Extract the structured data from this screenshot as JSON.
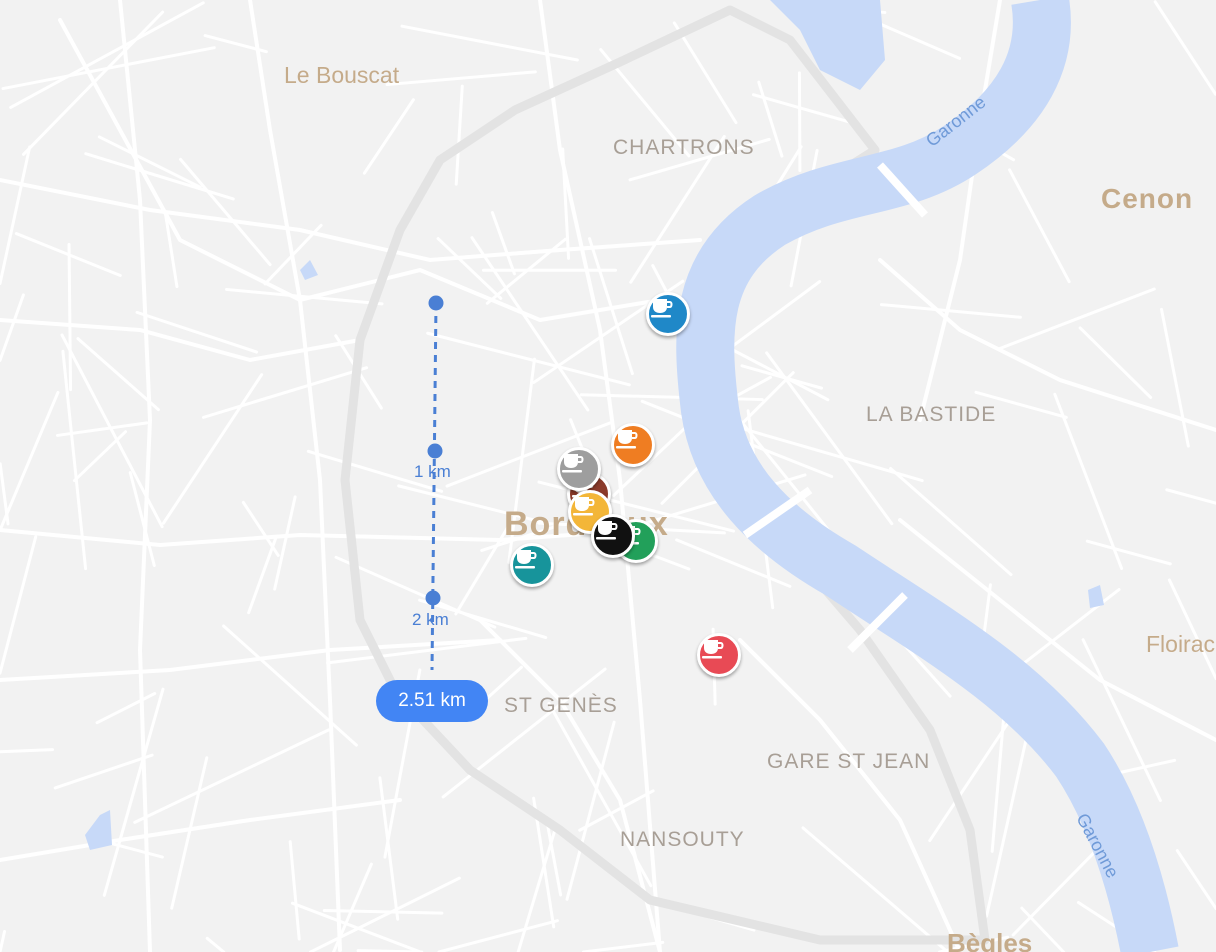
{
  "map": {
    "place_labels": [
      {
        "key": "le_bouscat",
        "text": "Le Bouscat"
      },
      {
        "key": "chartrons",
        "text": "CHARTRONS"
      },
      {
        "key": "cenon",
        "text": "Cenon"
      },
      {
        "key": "la_bastide",
        "text": "LA BASTIDE"
      },
      {
        "key": "bordeaux",
        "text": "Bordeaux"
      },
      {
        "key": "st_genes",
        "text": "ST GENÈS"
      },
      {
        "key": "gare_st_jean",
        "text": "GARE ST JEAN"
      },
      {
        "key": "nansouty",
        "text": "NANSOUTY"
      },
      {
        "key": "floirac",
        "text": "Floirac"
      },
      {
        "key": "begles",
        "text": "Bègles"
      }
    ],
    "river_labels": [
      {
        "key": "garonne_north",
        "text": "Garonne"
      },
      {
        "key": "garonne_south",
        "text": "Garonne"
      }
    ]
  },
  "measurement": {
    "markers": [
      {
        "key": "marker_1",
        "text": "1 km"
      },
      {
        "key": "marker_2",
        "text": "2 km"
      }
    ],
    "total": "2.51 km"
  },
  "cafe_pins": [
    {
      "key": "blue",
      "color": "#1f88c8",
      "icon": "coffee-cup-icon"
    },
    {
      "key": "orange",
      "color": "#ef7d22",
      "icon": "coffee-cup-icon"
    },
    {
      "key": "gray",
      "color": "#9e9e9e",
      "icon": "coffee-cup-icon"
    },
    {
      "key": "brown",
      "color": "#8b3a2a",
      "icon": "coffee-cup-icon"
    },
    {
      "key": "yellow",
      "color": "#f3b638",
      "icon": "coffee-cup-icon"
    },
    {
      "key": "green",
      "color": "#22a05a",
      "icon": "coffee-cup-icon"
    },
    {
      "key": "black",
      "color": "#111111",
      "icon": "coffee-cup-icon"
    },
    {
      "key": "teal",
      "color": "#17949b",
      "icon": "coffee-cup-icon"
    },
    {
      "key": "red",
      "color": "#e84a55",
      "icon": "coffee-cup-icon"
    }
  ],
  "colors": {
    "background": "#f2f2f2",
    "road": "#ffffff",
    "ring_road": "#e3e3e3",
    "water": "#c7d9f8",
    "district_label": "#a89f96",
    "town_label": "#c5ab8a",
    "river_label": "#6f9ad8",
    "measure_line": "#4a7fd4",
    "measure_pill": "#4285f4"
  }
}
